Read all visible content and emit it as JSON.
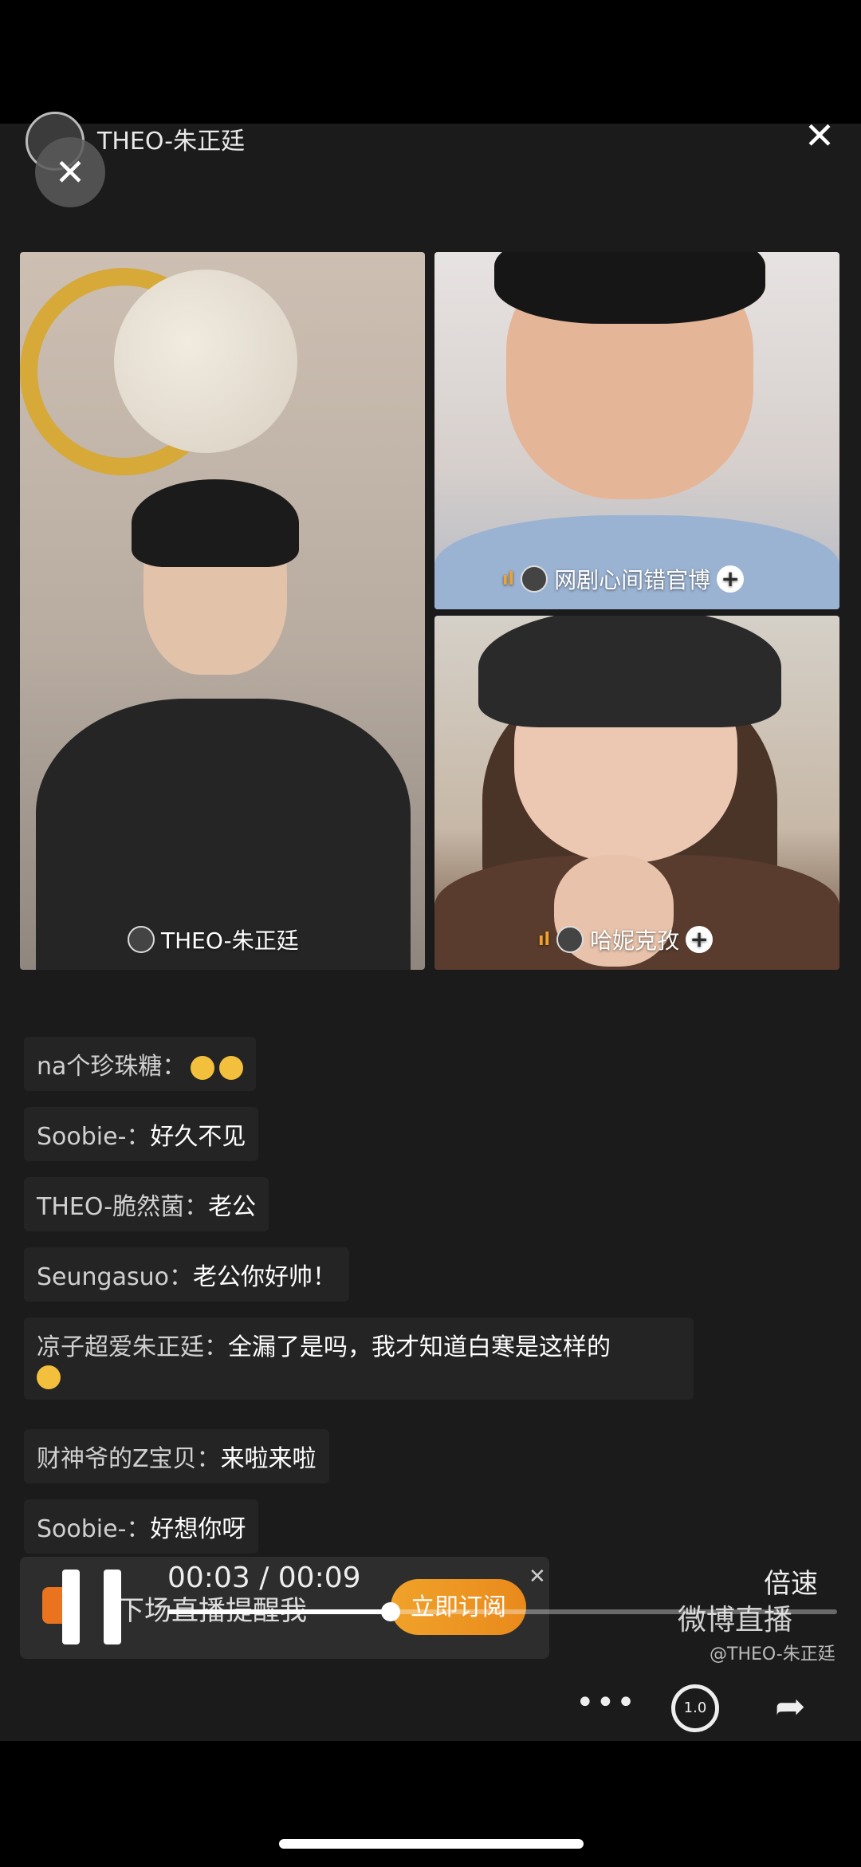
{
  "header": {
    "host_name": "THEO-朱正廷"
  },
  "tiles": {
    "main_label": "THEO-朱正廷",
    "top_right_label": "网剧心间错官博",
    "bottom_right_label": "哈妮克孜"
  },
  "comments": [
    {
      "user": "na个珍珠糖：",
      "text": ""
    },
    {
      "user": "Soobie-：",
      "text": "好久不见"
    },
    {
      "user": "THEO-脆然菌：",
      "text": "老公"
    },
    {
      "user": "Seungasuo：",
      "text": "老公你好帅！"
    },
    {
      "user": "凉子超爱朱正廷：",
      "text": "全漏了是吗，我才知道白寒是这样的"
    },
    {
      "user": "财神爷的Z宝贝：",
      "text": "来啦来啦"
    },
    {
      "user": "Soobie-：",
      "text": "好想你呀"
    }
  ],
  "subscribe": {
    "text": "下场直播提醒我",
    "button": "立即订阅"
  },
  "player": {
    "time": "00:03 / 00:09",
    "speed_label": "倍速",
    "progress": 0.333,
    "replay_speed": "1.0"
  },
  "watermark": {
    "brand": "微博直播",
    "handle": "@THEO-朱正廷"
  }
}
